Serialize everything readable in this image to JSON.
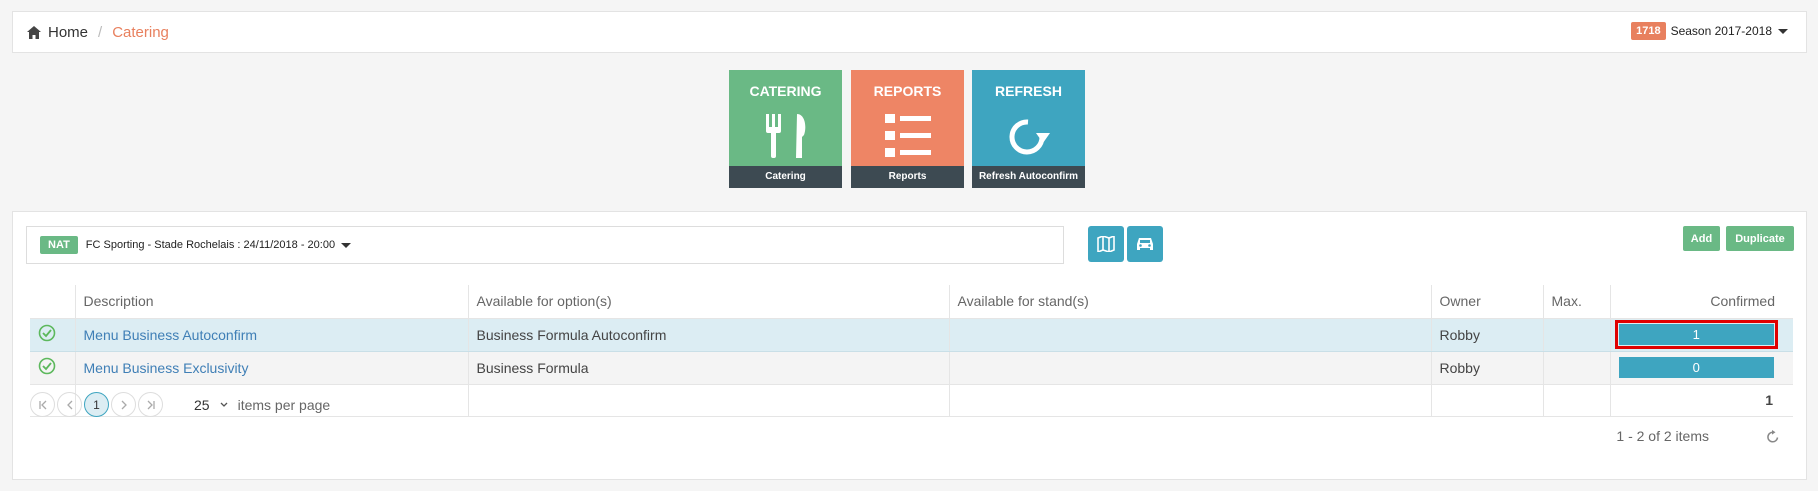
{
  "breadcrumb": {
    "home": "Home",
    "separator": "/",
    "current": "Catering"
  },
  "season": {
    "badge": "1718",
    "label": "Season 2017-2018"
  },
  "tiles": [
    {
      "title": "CATERING",
      "footer": "Catering",
      "icon": "fork-knife-icon",
      "color": "#6ab985"
    },
    {
      "title": "REPORTS",
      "footer": "Reports",
      "icon": "list-icon",
      "color": "#ee8565"
    },
    {
      "title": "REFRESH",
      "footer": "Refresh Autoconfirm",
      "icon": "refresh-icon",
      "color": "#3ea5c0"
    }
  ],
  "match": {
    "badge": "NAT",
    "label": "FC Sporting - Stade Rochelais : 24/11/2018 - 20:00"
  },
  "toolbar": {
    "add": "Add",
    "duplicate": "Duplicate",
    "map_icon": "map-icon",
    "car_icon": "car-icon"
  },
  "grid": {
    "columns": [
      "Description",
      "Available for option(s)",
      "Available for stand(s)",
      "Owner",
      "Max.",
      "Confirmed"
    ],
    "rows": [
      {
        "description": "Menu Business Autoconfirm",
        "options": "Business Formula Autoconfirm",
        "stands": "",
        "owner": "Robby",
        "max": "",
        "confirmed": "1"
      },
      {
        "description": "Menu Business Exclusivity",
        "options": "Business Formula",
        "stands": "",
        "owner": "Robby",
        "max": "",
        "confirmed": "0"
      }
    ],
    "total_confirmed": "1"
  },
  "pager": {
    "current_page": "1",
    "page_size": "25",
    "per_page_label": "items per page",
    "info": "1 - 2 of 2 items"
  },
  "colors": {
    "accent_green": "#6ab985",
    "accent_orange": "#e8805e",
    "accent_blue": "#3ea5c0",
    "dark_footer": "#3d4a52"
  }
}
